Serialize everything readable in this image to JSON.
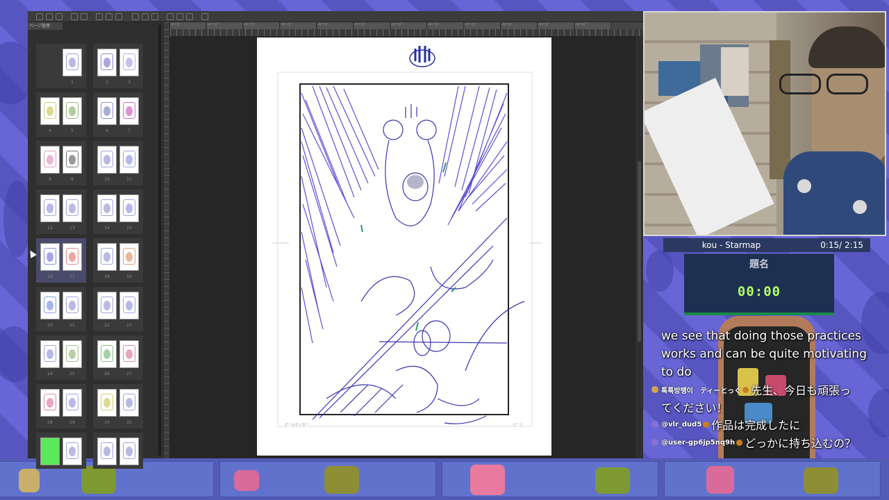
{
  "app": {
    "panel_tab": "ページ管理",
    "ruler_tabs": [
      "ページ",
      "ページ",
      "ページ",
      "ページ",
      "ページ",
      "ページ",
      "ページ",
      "ページ",
      "ページ",
      "ページ",
      "ページ",
      "ページ"
    ],
    "page_footer_left": "ゲームセンター",
    "page_footer_right": "ページ",
    "thumbnails": [
      {
        "left": "",
        "right": "1",
        "right_color": "#8a8ad6"
      },
      {
        "left": "2",
        "right": "3",
        "left_color": "#7b66c9",
        "right_color": "#9a9ae0"
      },
      {
        "left": "4",
        "right": "5",
        "left_color": "#c8c250",
        "right_color": "#7fa85a"
      },
      {
        "left": "6",
        "right": "7",
        "left_color": "#6b7ac0",
        "right_color": "#c84ab2"
      },
      {
        "left": "8",
        "right": "9",
        "left_color": "#d888b8",
        "right_color": "#555"
      },
      {
        "left": "10",
        "right": "11",
        "left_color": "#8a8ad6",
        "right_color": "#8a8ad6"
      },
      {
        "left": "12",
        "right": "13",
        "left_color": "#8a8ad6",
        "right_color": "#8a8ad6"
      },
      {
        "left": "14",
        "right": "15",
        "left_color": "#8a8ad6",
        "right_color": "#8a8ad6"
      },
      {
        "left": "16",
        "right": "17",
        "left_color": "#6b6bd6",
        "right_color": "#d86b6b"
      },
      {
        "left": "18",
        "right": "19",
        "left_color": "#8a8ad6",
        "right_color": "#d8885a"
      },
      {
        "left": "20",
        "right": "21",
        "left_color": "#6b8ad6",
        "right_color": "#8a8ad6"
      },
      {
        "left": "22",
        "right": "23",
        "left_color": "#8a8ad6",
        "right_color": "#8a8ad6"
      },
      {
        "left": "24",
        "right": "25",
        "left_color": "#8a8ad6",
        "right_color": "#8ab06b"
      },
      {
        "left": "26",
        "right": "27",
        "left_color": "#6bb06b",
        "right_color": "#d86b9a"
      },
      {
        "left": "28",
        "right": "29",
        "left_color": "#d86b9a",
        "right_color": "#8a8ad6"
      },
      {
        "left": "30",
        "right": "31",
        "left_color": "#c8c250",
        "right_color": "#8a8ad6"
      },
      {
        "left": "",
        "right": "",
        "left_color": "#5be85b",
        "right_color": "#8a8ad6"
      },
      {
        "left": "",
        "right": "",
        "left_color": "#8a8ad6",
        "right_color": "#8a8ad6"
      }
    ]
  },
  "music": {
    "title": "kou - Starmap",
    "time": "0:15/ 2:15"
  },
  "timer": {
    "label": "題名",
    "value": "00:00"
  },
  "caption": "we see that doing those practices works and can be quite motivating to do",
  "chat": [
    {
      "user": "톡톡방팽이　ティーとっぐ",
      "message": "先生、今日も頑張っ",
      "message_cont": "てください！"
    },
    {
      "user": "@vlr_dud5",
      "message": "作品は完成したに"
    },
    {
      "user": "@user-gp6jp5nq9h",
      "message": "どっかに持ち込むの？"
    }
  ],
  "colors": {
    "accent_timer": "#b4ff66",
    "timer_bar": "#1a8a47",
    "music_bar": "#2b3960"
  }
}
